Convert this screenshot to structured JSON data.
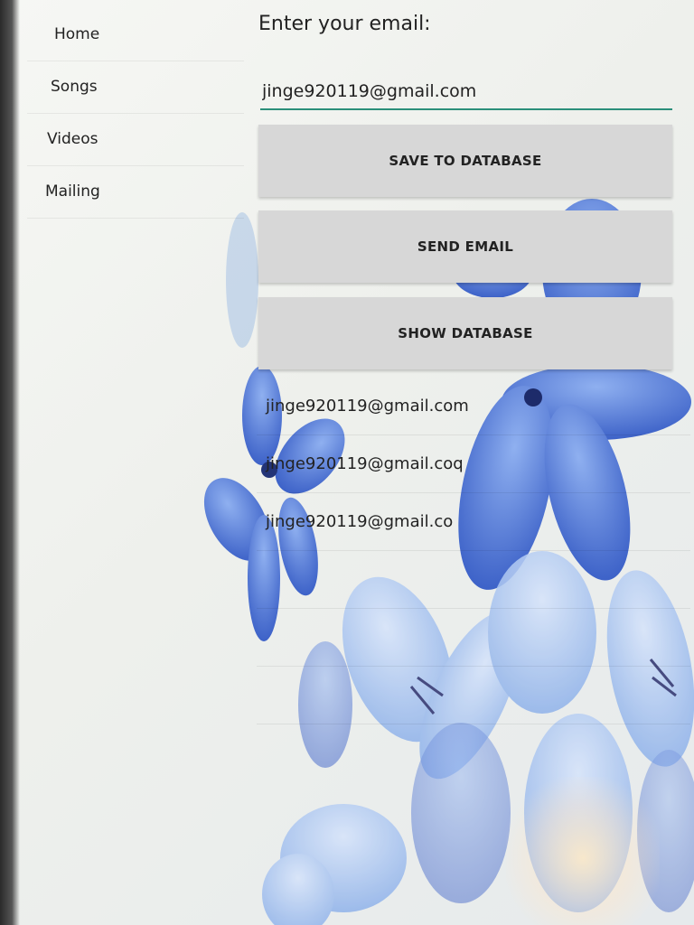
{
  "sidebar": {
    "items": [
      {
        "label": "Home"
      },
      {
        "label": "Songs"
      },
      {
        "label": "Videos"
      },
      {
        "label": "Mailing"
      }
    ]
  },
  "mailing": {
    "prompt": "Enter your email:",
    "email_value": "jinge920119@gmail.com",
    "buttons": {
      "save": "SAVE TO DATABASE",
      "send": "SEND EMAIL",
      "show": "SHOW DATABASE"
    },
    "records": [
      "jinge920119@gmail.com",
      "jinge920119@gmail.coq",
      "jinge920119@gmail.co"
    ]
  },
  "colors": {
    "accent_underline": "#2b8f7a",
    "button_bg": "#d7d7d7",
    "flower_blue": "#4a6fd0"
  }
}
